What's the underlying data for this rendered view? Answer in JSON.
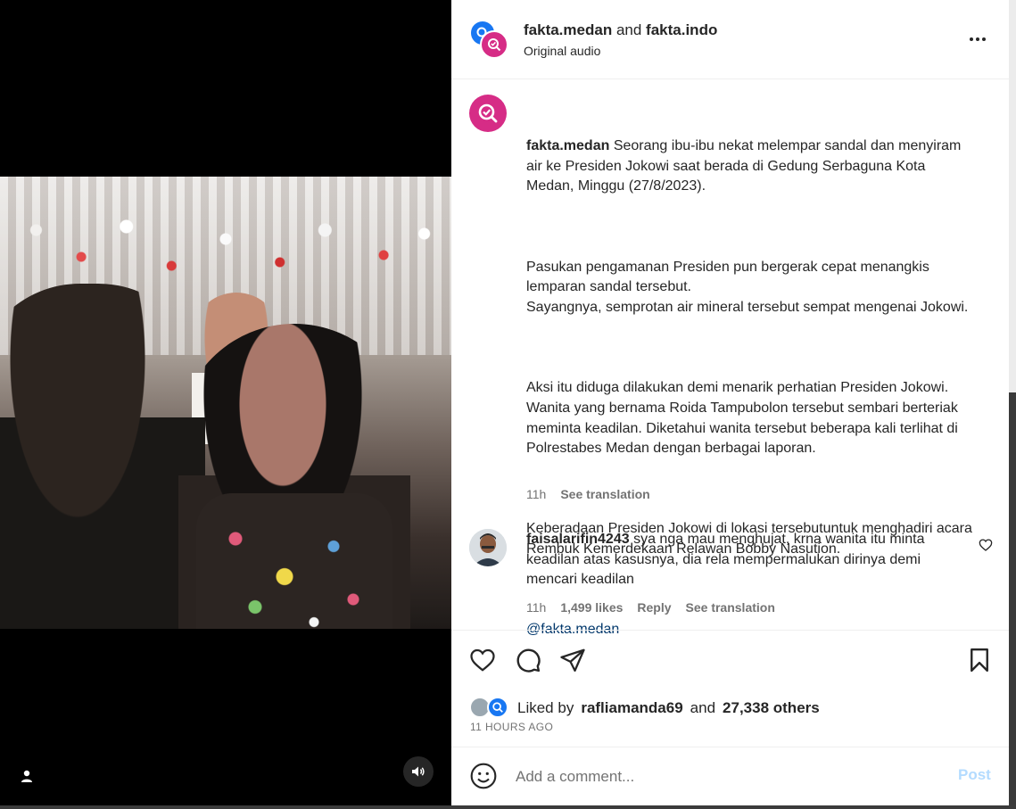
{
  "header": {
    "author_primary": "fakta.medan",
    "joiner": "and",
    "author_secondary": "fakta.indo",
    "subtitle": "Original audio",
    "more_icon": "more-horizontal-icon"
  },
  "caption": {
    "username": "fakta.medan",
    "paragraphs": [
      "Seorang ibu-ibu nekat melempar sandal dan menyiram air ke Presiden Jokowi saat berada di Gedung Serbaguna Kota Medan, Minggu (27/8/2023).",
      "Pasukan pengamanan Presiden pun bergerak cepat menangkis lemparan sandal tersebut.\nSayangnya, semprotan air mineral tersebut sempat mengenai Jokowi.",
      "Aksi itu diduga dilakukan demi menarik perhatian Presiden Jokowi. Wanita yang bernama Roida Tampubolon tersebut sembari berteriak meminta keadilan. Diketahui wanita tersebut beberapa kali terlihat di Polrestabes Medan dengan berbagai laporan.",
      "Keberadaan Presiden Jokowi di lokasi tersebutuntuk menghadiri acara Rembuk Kemerdekaan Relawan Bobby Nasution."
    ],
    "mention": "@fakta.medan",
    "time": "11h",
    "see_translation": "See translation"
  },
  "comment": {
    "username": "faisalarifin4243",
    "text": "sya nga mau menghujat, krna wanita itu minta keadilan atas kasusnya, dia rela mempermalukan dirinya demi mencari keadilan",
    "time": "11h",
    "likes": "1,499 likes",
    "reply": "Reply",
    "see_translation": "See translation"
  },
  "actions": {
    "liked_by_prefix": "Liked by",
    "liked_by_user": "rafliamanda69",
    "liked_by_joiner": "and",
    "liked_by_others": "27,338 others",
    "timestamp": "11 HOURS AGO"
  },
  "comment_bar": {
    "placeholder": "Add a comment...",
    "post_label": "Post"
  },
  "colors": {
    "text": "#262626",
    "secondary": "#737373",
    "link": "#00376b",
    "post_disabled": "#b3dbff",
    "brand_pink": "#d62c86",
    "brand_blue": "#1877f2"
  }
}
